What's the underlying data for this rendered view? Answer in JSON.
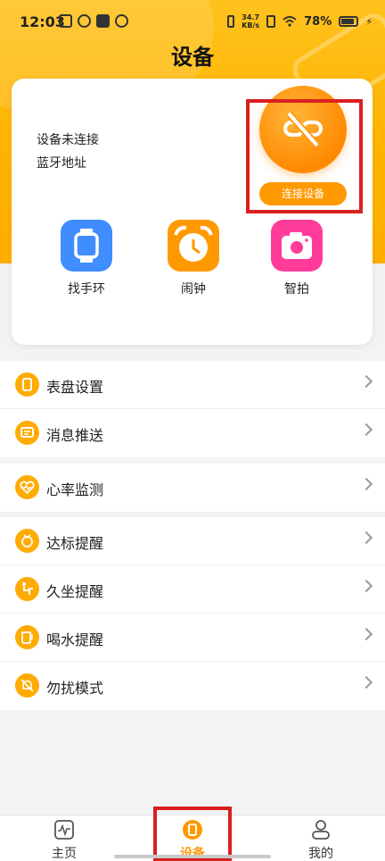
{
  "status_bar": {
    "time": "12:03",
    "network_speed": "34.7",
    "network_speed_unit": "KB/s",
    "battery": "78%"
  },
  "header": {
    "title": "设备"
  },
  "device_card": {
    "connection_status": "设备未连接",
    "bluetooth_address_label": "蓝牙地址",
    "connect_button": "连接设备",
    "quick_actions": [
      {
        "label": "找手环",
        "icon": "watch-icon",
        "color": "#3f8dff"
      },
      {
        "label": "闹钟",
        "icon": "alarm-clock-icon",
        "color": "#ff9900"
      },
      {
        "label": "智拍",
        "icon": "camera-icon",
        "color": "#ff3c9a"
      }
    ]
  },
  "settings": {
    "group1": [
      {
        "label": "表盘设置",
        "icon": "watch-face-icon"
      },
      {
        "label": "消息推送",
        "icon": "message-icon"
      }
    ],
    "group2": [
      {
        "label": "心率监测",
        "icon": "heart-rate-icon"
      }
    ],
    "group3": [
      {
        "label": "达标提醒",
        "icon": "goal-icon"
      },
      {
        "label": "久坐提醒",
        "icon": "sedentary-icon"
      },
      {
        "label": "喝水提醒",
        "icon": "cup-icon"
      },
      {
        "label": "勿扰模式",
        "icon": "bell-mute-icon"
      }
    ]
  },
  "tab_bar": {
    "tabs": [
      {
        "label": "主页",
        "icon": "activity-icon"
      },
      {
        "label": "设备",
        "icon": "device-icon",
        "active": true
      },
      {
        "label": "我的",
        "icon": "user-icon"
      }
    ]
  },
  "colors": {
    "accent": "#ff9900",
    "highlight_box": "#d9201f"
  }
}
